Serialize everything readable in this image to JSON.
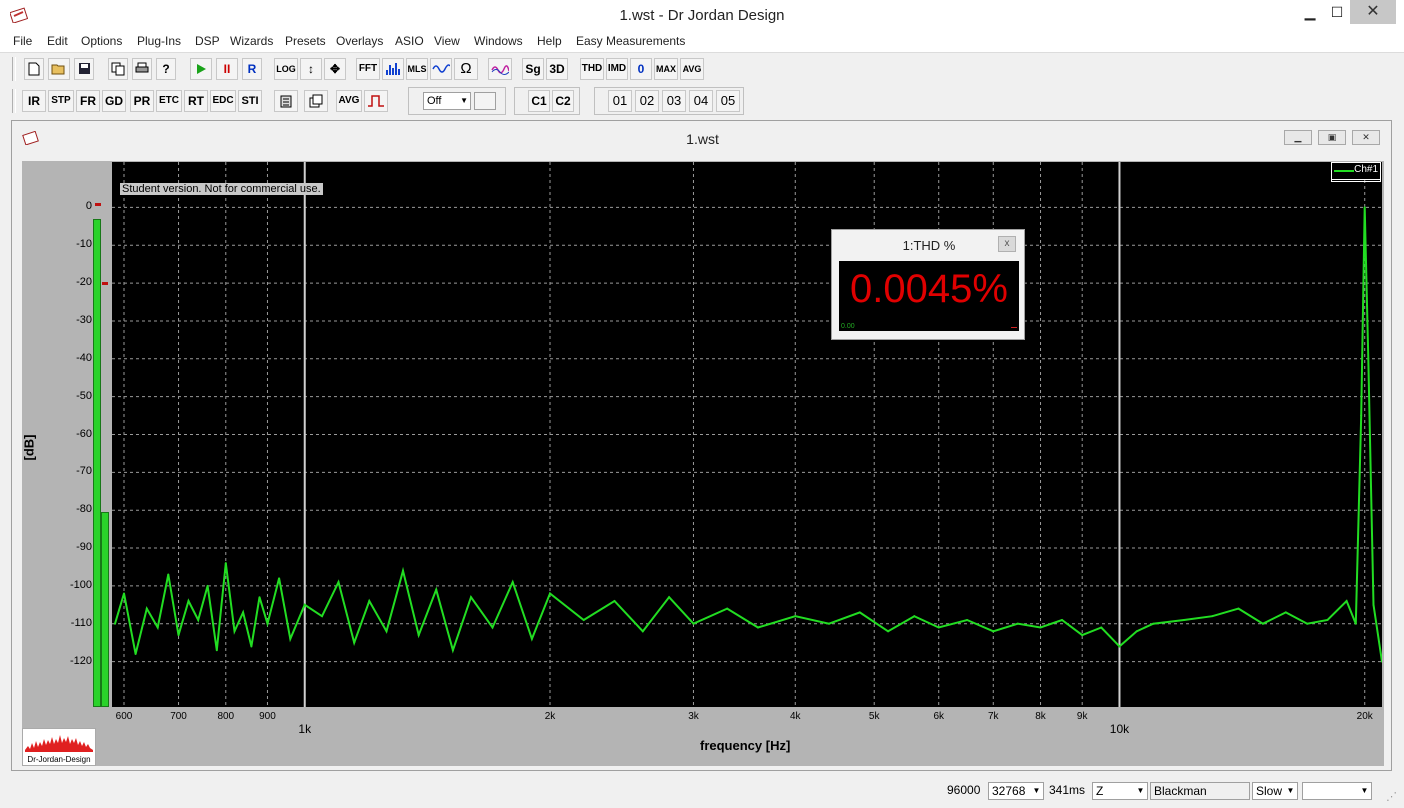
{
  "window": {
    "title": "1.wst - Dr Jordan Design",
    "min": "▁",
    "max": "☐",
    "close": "✕"
  },
  "menu": [
    "File",
    "Edit",
    "Options",
    "Plug-Ins",
    "DSP",
    "Wizards",
    "Presets",
    "Overlays",
    "ASIO",
    "View",
    "Windows",
    "Help",
    "Easy Measurements"
  ],
  "toolbar1": {
    "buttons": [
      "new-icon",
      "open-icon",
      "save-icon",
      "copy-icon",
      "print-icon",
      "help-icon",
      "play-icon",
      "pause-icon",
      "R",
      "LOG",
      "vertical-arrow-icon",
      "move-icon",
      "FFT",
      "spectrum-icon",
      "MLS",
      "sine-icon",
      "Ω",
      "overlay-wave-icon",
      "Sg",
      "3D",
      "THD",
      "IMD",
      "0",
      "MAX",
      "AVG"
    ]
  },
  "toolbar2": {
    "buttons": [
      "IR",
      "STP",
      "FR",
      "GD",
      "PR",
      "ETC",
      "RT",
      "EDC",
      "STI"
    ],
    "avg_label": "AVG",
    "dropdown_value": "Off",
    "channels": [
      "C1",
      "C2"
    ],
    "presets": [
      "01",
      "02",
      "03",
      "04",
      "05"
    ]
  },
  "inner_window": {
    "title": "1.wst"
  },
  "plot": {
    "student_note": "Student version. Not for commercial use.",
    "legend": "Ch#1",
    "ylabel": "[dB]",
    "xlabel": "frequency [Hz]",
    "logo_text": "Dr-Jordan-Design"
  },
  "chart_data": {
    "type": "line",
    "xlabel": "frequency [Hz]",
    "ylabel": "[dB]",
    "xscale": "log",
    "xlim": [
      580,
      21000
    ],
    "ylim": [
      -132,
      12
    ],
    "yticks": [
      0,
      -10,
      -20,
      -30,
      -40,
      -50,
      -60,
      -70,
      -80,
      -90,
      -100,
      -110,
      -120
    ],
    "xticks_minor": [
      "600",
      "700",
      "800",
      "900",
      "2k",
      "3k",
      "4k",
      "5k",
      "6k",
      "7k",
      "8k",
      "9k",
      "20k"
    ],
    "xticks_minor_values": [
      600,
      700,
      800,
      900,
      2000,
      3000,
      4000,
      5000,
      6000,
      7000,
      8000,
      9000,
      20000
    ],
    "xticks_major": [
      "1k",
      "10k"
    ],
    "xticks_major_values": [
      1000,
      10000
    ],
    "series": [
      {
        "name": "Ch#1",
        "color": "#22dd22",
        "x": [
          585,
          600,
          620,
          640,
          660,
          680,
          700,
          720,
          740,
          760,
          780,
          800,
          820,
          840,
          860,
          880,
          900,
          930,
          960,
          1000,
          1050,
          1100,
          1150,
          1200,
          1260,
          1320,
          1380,
          1450,
          1520,
          1600,
          1700,
          1800,
          1900,
          2000,
          2200,
          2400,
          2600,
          2800,
          3000,
          3300,
          3600,
          4000,
          4400,
          4800,
          5200,
          5600,
          6000,
          6500,
          7000,
          7500,
          8000,
          8500,
          9000,
          9500,
          10000,
          10500,
          11000,
          12000,
          13000,
          14000,
          15000,
          16000,
          17000,
          18000,
          19000,
          19500,
          19800,
          20000,
          20200,
          20500,
          21000
        ],
        "values": [
          -110,
          -102,
          -118,
          -106,
          -111,
          -97,
          -113,
          -104,
          -109,
          -100,
          -117,
          -94,
          -112,
          -107,
          -116,
          -103,
          -110,
          -98,
          -114,
          -105,
          -108,
          -99,
          -115,
          -104,
          -112,
          -96,
          -113,
          -101,
          -117,
          -103,
          -111,
          -99,
          -114,
          -102,
          -109,
          -104,
          -112,
          -103,
          -110,
          -106,
          -111,
          -108,
          -110,
          -107,
          -112,
          -108,
          -111,
          -109,
          -112,
          -110,
          -111,
          -109,
          -113,
          -111,
          -116,
          -112,
          -110,
          -109,
          -108,
          -106,
          -110,
          -107,
          -110,
          -109,
          -104,
          -110,
          -55,
          0,
          -40,
          -105,
          -120
        ]
      }
    ]
  },
  "thd_popup": {
    "title": "1:THD %",
    "value": "0.0045%",
    "mini_value": "0.00",
    "close": "x"
  },
  "status": {
    "rate": "96000",
    "fft_size": "32768",
    "time": "341ms",
    "weighting": "Z",
    "window": "Blackman",
    "speed": "Slow",
    "extra": ""
  },
  "colors": {
    "trace": "#22dd22",
    "thd_value": "#e00000",
    "meter": "#2ad22a",
    "plot_bg": "#000000"
  }
}
